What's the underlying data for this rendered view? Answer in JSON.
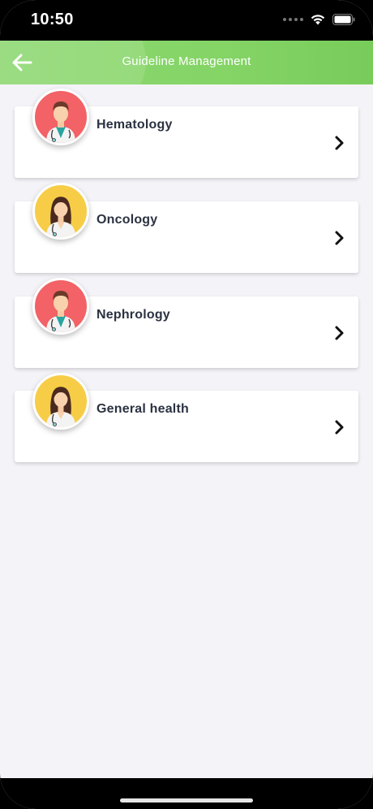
{
  "status_bar": {
    "time": "10:50",
    "icons": [
      "signal-dots-icon",
      "wifi-icon",
      "battery-icon"
    ]
  },
  "header": {
    "title": "Guideline Management",
    "back_icon": "arrow-left-icon",
    "color": "#86d46a"
  },
  "items": [
    {
      "label": "Hematology",
      "avatar": "male-doctor",
      "avatar_bg": "#f26266",
      "chevron_icon": "chevron-right-icon"
    },
    {
      "label": "Oncology",
      "avatar": "female-doctor",
      "avatar_bg": "#f7cd47",
      "chevron_icon": "chevron-right-icon"
    },
    {
      "label": "Nephrology",
      "avatar": "male-doctor",
      "avatar_bg": "#f26266",
      "chevron_icon": "chevron-right-icon"
    },
    {
      "label": "General health",
      "avatar": "female-doctor",
      "avatar_bg": "#f7cd47",
      "chevron_icon": "chevron-right-icon"
    }
  ]
}
